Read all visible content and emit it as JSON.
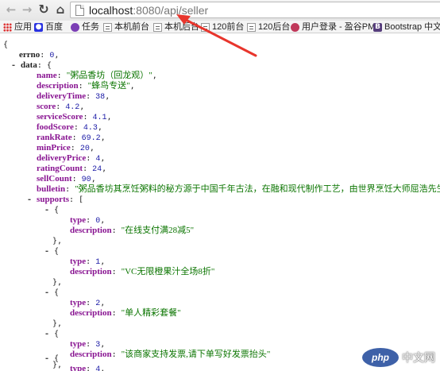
{
  "browser": {
    "url_host": "localhost",
    "url_rest": ":8080/api/seller",
    "icons": [
      "back-arrow-icon",
      "forward-arrow-icon",
      "reload-icon",
      "home-icon",
      "page-icon"
    ]
  },
  "bookmarks": [
    {
      "label": "应用",
      "icon": "apps-grid-icon"
    },
    {
      "label": "百度",
      "icon": "baidu-icon"
    },
    {
      "label": "任务",
      "icon": "task-icon"
    },
    {
      "label": "本机前台",
      "icon": "document-icon"
    },
    {
      "label": "本机后台",
      "icon": "document-icon"
    },
    {
      "label": "120前台",
      "icon": "document-icon"
    },
    {
      "label": "120后台",
      "icon": "document-icon"
    },
    {
      "label": "用户登录 - 盈谷PM",
      "icon": "user-icon"
    },
    {
      "label": "Bootstrap 中文网",
      "icon": "bootstrap-icon"
    }
  ],
  "json": {
    "open_brace": "{",
    "errno": {
      "key": "errno",
      "value": "0"
    },
    "data_key": "data",
    "data": {
      "name": {
        "key": "name",
        "value": "\"粥品香坊（回龙观）\""
      },
      "description": {
        "key": "description",
        "value": "\"蜂鸟专送\""
      },
      "deliveryTime": {
        "key": "deliveryTime",
        "value": "38"
      },
      "score": {
        "key": "score",
        "value": "4.2"
      },
      "serviceScore": {
        "key": "serviceScore",
        "value": "4.1"
      },
      "foodScore": {
        "key": "foodScore",
        "value": "4.3"
      },
      "rankRate": {
        "key": "rankRate",
        "value": "69.2"
      },
      "minPrice": {
        "key": "minPrice",
        "value": "20"
      },
      "deliveryPrice": {
        "key": "deliveryPrice",
        "value": "4"
      },
      "ratingCount": {
        "key": "ratingCount",
        "value": "24"
      },
      "sellCount": {
        "key": "sellCount",
        "value": "90"
      },
      "bulletin": {
        "key": "bulletin",
        "value": "\"粥品香坊其烹饪粥料的秘方源于中国千年古法，在融和现代制作工艺，由世界烹饪大师屈浩先生领衔研发。坚"
      }
    },
    "supports_key": "supports",
    "supports": [
      {
        "type": "0",
        "description": "\"在线支付满28减5\""
      },
      {
        "type": "1",
        "description": "\"VC无限橙果汁全场8折\""
      },
      {
        "type": "2",
        "description": "\"单人精彩套餐\""
      },
      {
        "type": "3",
        "description": "\"该商家支持发票,请下单写好发票抬头\""
      },
      {
        "type": "4",
        "description": ""
      }
    ],
    "type_key": "type",
    "description_key": "description"
  },
  "watermark": {
    "logo": "php",
    "text": "中文网"
  },
  "colors": {
    "annotation_arrow": "#e8352c",
    "key": "#881391",
    "string": "#0b7500",
    "number": "#1a1aa6"
  }
}
